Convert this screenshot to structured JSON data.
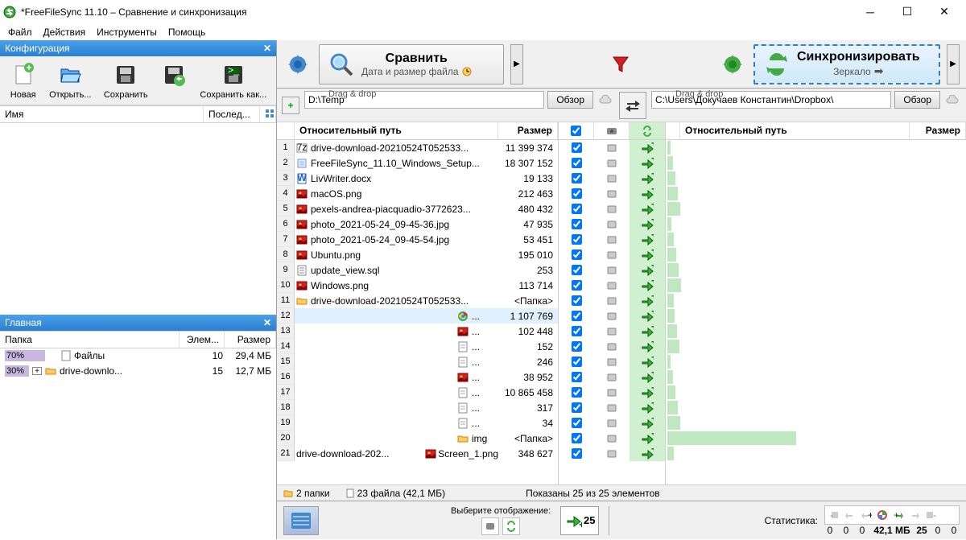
{
  "window": {
    "title": "*FreeFileSync 11.10 – Сравнение и синхронизация"
  },
  "menu": {
    "file": "Файл",
    "actions": "Действия",
    "tools": "Инструменты",
    "help": "Помощь"
  },
  "config_panel": {
    "title": "Конфигурация",
    "new": "Новая",
    "open": "Открыть...",
    "save": "Сохранить",
    "save_as": "Сохранить как...",
    "col_name": "Имя",
    "col_last": "Послед..."
  },
  "main_panel": {
    "title": "Главная",
    "col_folder": "Папка",
    "col_elem": "Элем...",
    "col_size": "Размер",
    "rows": [
      {
        "pct": "70%",
        "pct_w": 50,
        "name": "Файлы",
        "count": "10",
        "size": "29,4 МБ",
        "expand": false,
        "icon": "file"
      },
      {
        "pct": "30%",
        "pct_w": 30,
        "name": "drive-downlo...",
        "count": "15",
        "size": "12,7 МБ",
        "expand": true,
        "icon": "folder"
      }
    ]
  },
  "toolbar": {
    "compare": "Сравнить",
    "compare_sub": "Дата и размер файла",
    "sync": "Синхронизировать",
    "sync_sub": "Зеркало"
  },
  "paths": {
    "drag_drop": "Drag & drop",
    "left": "D:\\Temp",
    "right": "C:\\Users\\Докучаев Константин\\Dropbox\\",
    "browse": "Обзор"
  },
  "file_headers": {
    "rel_path": "Относительный путь",
    "size": "Размер"
  },
  "files": [
    {
      "n": "1",
      "icon": "7z",
      "name": "drive-download-20210524T052533...",
      "size": "11 399 374"
    },
    {
      "n": "2",
      "icon": "exe",
      "name": "FreeFileSync_11.10_Windows_Setup...",
      "size": "18 307 152"
    },
    {
      "n": "3",
      "icon": "docx",
      "name": "LivWriter.docx",
      "size": "19 133"
    },
    {
      "n": "4",
      "icon": "img",
      "name": "macOS.png",
      "size": "212 463"
    },
    {
      "n": "5",
      "icon": "img",
      "name": "pexels-andrea-piacquadio-3772623...",
      "size": "480 432"
    },
    {
      "n": "6",
      "icon": "img",
      "name": "photo_2021-05-24_09-45-36.jpg",
      "size": "47 935"
    },
    {
      "n": "7",
      "icon": "img",
      "name": "photo_2021-05-24_09-45-54.jpg",
      "size": "53 451"
    },
    {
      "n": "8",
      "icon": "img",
      "name": "Ubuntu.png",
      "size": "195 010"
    },
    {
      "n": "9",
      "icon": "sql",
      "name": "update_view.sql",
      "size": "253"
    },
    {
      "n": "10",
      "icon": "img",
      "name": "Windows.png",
      "size": "113 714"
    },
    {
      "n": "11",
      "icon": "folder",
      "name": "drive-download-20210524T052533...",
      "size": "<Папка>",
      "folder": true,
      "indent": 0
    },
    {
      "n": "12",
      "icon": "chrome",
      "name": "...",
      "size": "1 107 769",
      "indent": 1,
      "sel": true
    },
    {
      "n": "13",
      "icon": "img",
      "name": "...",
      "size": "102 448",
      "indent": 1
    },
    {
      "n": "14",
      "icon": "file",
      "name": "...",
      "size": "152",
      "indent": 1
    },
    {
      "n": "15",
      "icon": "file",
      "name": "...",
      "size": "246",
      "indent": 1
    },
    {
      "n": "16",
      "icon": "img",
      "name": "...",
      "size": "38 952",
      "indent": 1
    },
    {
      "n": "17",
      "icon": "file",
      "name": "...",
      "size": "10 865 458",
      "indent": 1
    },
    {
      "n": "18",
      "icon": "file",
      "name": "...",
      "size": "317",
      "indent": 1
    },
    {
      "n": "19",
      "icon": "file",
      "name": "...",
      "size": "34",
      "indent": 1
    },
    {
      "n": "20",
      "icon": "folder",
      "name": "img",
      "size": "<Папка>",
      "folder": true,
      "indent": 1
    },
    {
      "n": "21",
      "icon": "",
      "name": "drive-download-202...",
      "name2": "Screen_1.png",
      "icon2": "img",
      "size": "348 627",
      "indent": 0,
      "split": true
    }
  ],
  "status": {
    "folders": "2 папки",
    "files": "23 файла (42,1 МБ)",
    "shown": "Показаны 25 из 25 элементов"
  },
  "bottom": {
    "display_label": "Выберите отображение:",
    "big_count": "25",
    "stats_label": "Статистика:",
    "stats": [
      "0",
      "0",
      "0",
      "42,1 МБ",
      "25",
      "0",
      "0"
    ]
  }
}
